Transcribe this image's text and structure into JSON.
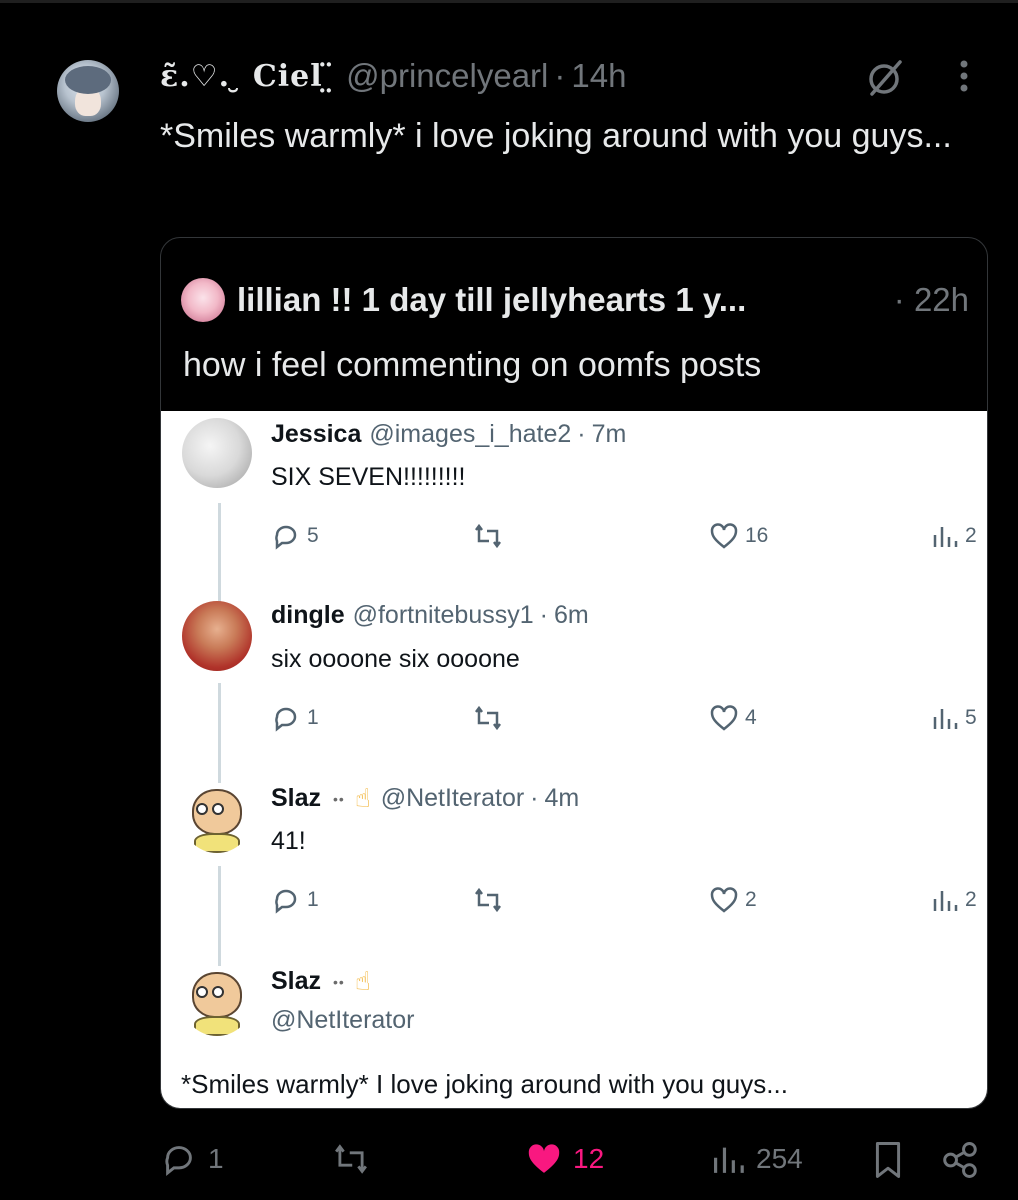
{
  "post": {
    "display_name": "ɛ̃.♡. ̮ Ciel ̤̈",
    "handle": "@princelyearl",
    "dot": "·",
    "time": "14h",
    "text": "*Smiles warmly* i love joking around with you guys...",
    "stats": {
      "replies": "1",
      "likes": "12",
      "views": "254"
    },
    "colors": {
      "like": "#f91880",
      "muted": "#71767b"
    }
  },
  "quote": {
    "name": "lillian !! 1 day till jellyhearts 1 y...",
    "time": "· 22h",
    "text": "how i feel commenting on oomfs posts",
    "media": {
      "comments": [
        {
          "name": "Jessica",
          "handle": "@images_i_hate2",
          "dot": "·",
          "time": "7m",
          "text": "SIX SEVEN!!!!!!!!!",
          "replies": "5",
          "likes": "16",
          "views": "2"
        },
        {
          "name": "dingle",
          "handle": "@fortnitebussy1",
          "dot": "·",
          "time": "6m",
          "text": "six oooone six oooone",
          "replies": "1",
          "likes": "4",
          "views": "5"
        },
        {
          "name": "Slaz",
          "emoji_eyes": "••",
          "emoji_point": "☝",
          "handle": "@NetIterator",
          "dot": "·",
          "time": "4m",
          "text": "41!",
          "replies": "1",
          "likes": "2",
          "views": "2"
        },
        {
          "name": "Slaz",
          "emoji_eyes": "••",
          "emoji_point": "☝",
          "handle": "@NetIterator"
        }
      ],
      "final_text": "*Smiles warmly* I love joking around with you guys..."
    }
  }
}
